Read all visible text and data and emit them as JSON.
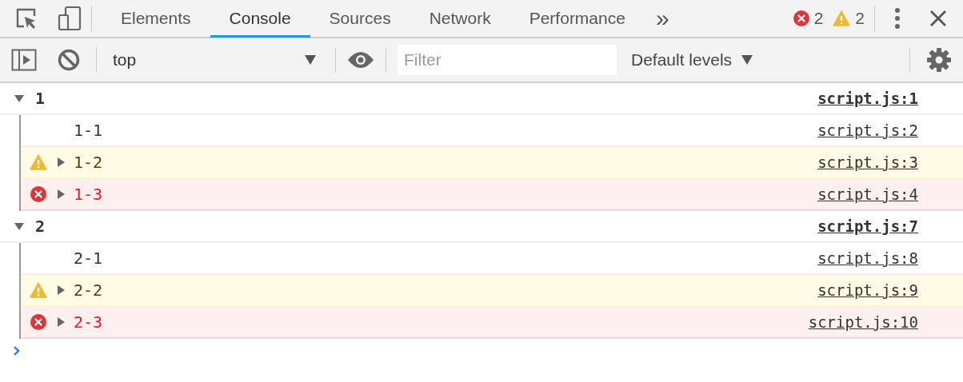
{
  "tabs": [
    {
      "label": "Elements",
      "selected": false
    },
    {
      "label": "Console",
      "selected": true
    },
    {
      "label": "Sources",
      "selected": false
    },
    {
      "label": "Network",
      "selected": false
    },
    {
      "label": "Performance",
      "selected": false
    }
  ],
  "more_tabs": "»",
  "counts": {
    "errors": "2",
    "warnings": "2"
  },
  "console_toolbar": {
    "context": "top",
    "filter": {
      "placeholder": "Filter"
    },
    "levels": "Default levels"
  },
  "groups": [
    {
      "label": "1",
      "expanded": true,
      "source": "script.js:1",
      "children": [
        {
          "kind": "log",
          "text": "1-1",
          "source": "script.js:2"
        },
        {
          "kind": "warning",
          "text": "1-2",
          "expanded": false,
          "source": "script.js:3"
        },
        {
          "kind": "error",
          "text": "1-3",
          "expanded": false,
          "source": "script.js:4"
        }
      ]
    },
    {
      "label": "2",
      "expanded": true,
      "source": "script.js:7",
      "children": [
        {
          "kind": "log",
          "text": "2-1",
          "source": "script.js:8"
        },
        {
          "kind": "warning",
          "text": "2-2",
          "expanded": false,
          "source": "script.js:9"
        },
        {
          "kind": "error",
          "text": "2-3",
          "expanded": false,
          "source": "script.js:10"
        }
      ]
    }
  ]
}
